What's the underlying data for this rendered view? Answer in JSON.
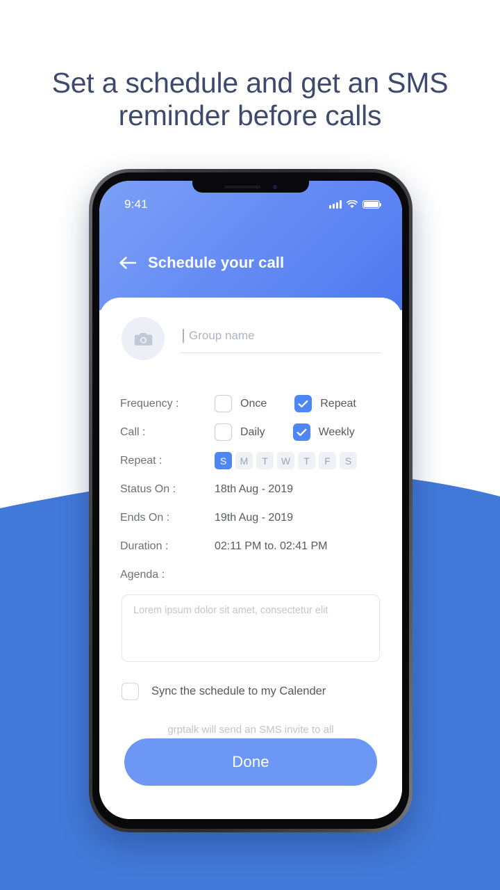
{
  "page": {
    "headline_line1": "Set a schedule and get an SMS",
    "headline_line2": "reminder before calls",
    "background_white": "#ffffff",
    "background_blue": "#4279d8"
  },
  "statusbar": {
    "time": "9:41",
    "signal_icon": "cellular-bars-icon",
    "wifi_icon": "wifi-icon",
    "battery_icon": "battery-icon"
  },
  "header": {
    "back_icon": "back-arrow-icon",
    "title": "Schedule your call",
    "accent": "#6a8ff5"
  },
  "identity": {
    "avatar_icon": "camera-icon",
    "group_name_value": "",
    "group_name_placeholder": "Group name"
  },
  "form": {
    "frequency": {
      "label": "Frequency :",
      "options": [
        {
          "label": "Once",
          "checked": false
        },
        {
          "label": "Repeat",
          "checked": true
        }
      ]
    },
    "call": {
      "label": "Call :",
      "options": [
        {
          "label": "Daily",
          "checked": false
        },
        {
          "label": "Weekly",
          "checked": true
        }
      ]
    },
    "repeat": {
      "label": "Repeat :",
      "days": [
        {
          "letter": "S",
          "active": true
        },
        {
          "letter": "M",
          "active": false
        },
        {
          "letter": "T",
          "active": false
        },
        {
          "letter": "W",
          "active": false
        },
        {
          "letter": "T",
          "active": false
        },
        {
          "letter": "F",
          "active": false
        },
        {
          "letter": "S",
          "active": false
        }
      ]
    },
    "status_on": {
      "label": "Status On :",
      "value": "18th Aug - 2019"
    },
    "ends_on": {
      "label": "Ends On :",
      "value": "19th Aug - 2019"
    },
    "duration": {
      "label": "Duration :",
      "value": "02:11 PM  to. 02:41 PM"
    },
    "agenda": {
      "label": "Agenda :",
      "value": "",
      "placeholder": "Lorem ipsum dolor sit amet, consectetur elit"
    },
    "sync": {
      "label": "Sync the schedule to my Calender",
      "checked": false
    },
    "sms_note_line1": "grptalk will send an SMS invite to",
    "sms_note_line2": "all members"
  },
  "footer": {
    "done_label": "Done",
    "done_color": "#6c97f5"
  },
  "colors": {
    "checkbox_checked": "#4f86f7",
    "pill_active": "#4f86f7",
    "pill_idle": "#eef1f6",
    "headline_text": "#3e4a6b"
  }
}
